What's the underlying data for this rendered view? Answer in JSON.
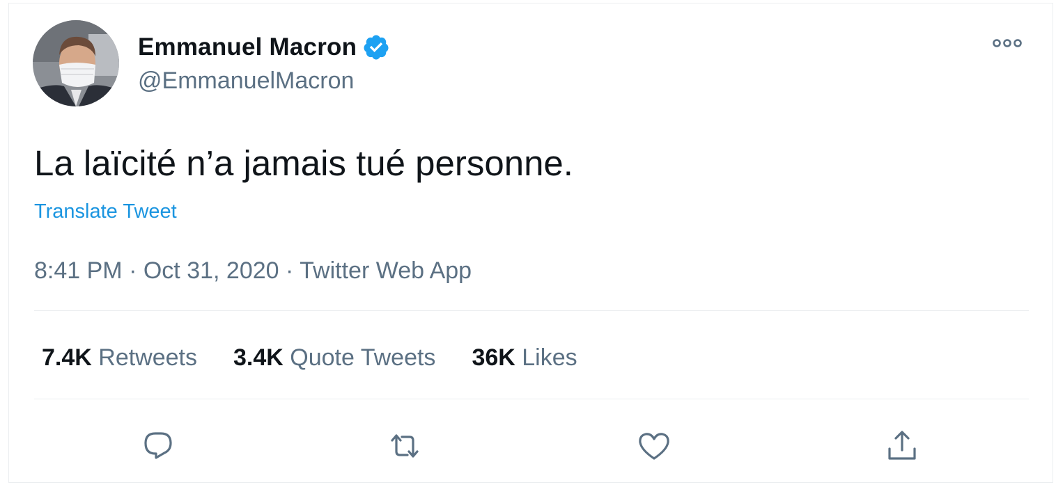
{
  "tweet": {
    "author": {
      "display_name": "Emmanuel Macron",
      "handle": "@EmmanuelMacron",
      "verified": true,
      "avatar_icon": "profile-photo"
    },
    "text": "La laïcité n’a jamais tué personne.",
    "translate_label": "Translate Tweet",
    "time": "8:41 PM",
    "date": "Oct 31, 2020",
    "source": "Twitter Web App",
    "separator": "·",
    "stats": [
      {
        "value": "7.4K",
        "label": "Retweets"
      },
      {
        "value": "3.4K",
        "label": "Quote Tweets"
      },
      {
        "value": "36K",
        "label": "Likes"
      }
    ],
    "actions": [
      "reply-icon",
      "retweet-icon",
      "like-icon",
      "share-icon"
    ],
    "more_icon": "more-options-icon"
  },
  "colors": {
    "text_primary": "#0f1419",
    "text_secondary": "#5b7083",
    "link": "#1b95e0",
    "verified_badge": "#1da1f2",
    "divider": "#ebeef0"
  }
}
